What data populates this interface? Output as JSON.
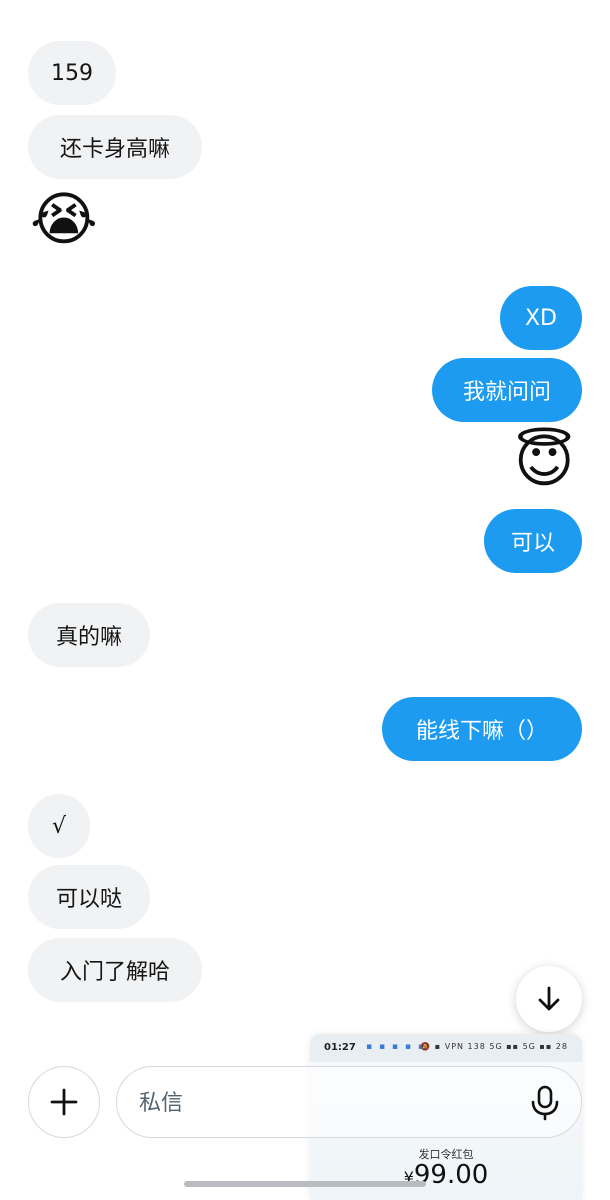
{
  "header": {
    "clipped_text": "· · · · · · · · · · ·"
  },
  "messages": [
    {
      "side": "in",
      "text": "159"
    },
    {
      "side": "in",
      "text": "还卡身高嘛"
    },
    {
      "side": "in",
      "emoji": "😭",
      "icon": "loudly-crying-face"
    },
    {
      "side": "out",
      "text": "XD"
    },
    {
      "side": "out",
      "text": "我就问问"
    },
    {
      "side": "out",
      "emoji": "😇",
      "icon": "smiling-face-with-halo"
    },
    {
      "side": "out",
      "text": "可以"
    },
    {
      "side": "in",
      "text": "真的嘛"
    },
    {
      "side": "out",
      "text": "能线下嘛（）"
    },
    {
      "side": "in",
      "text": "√"
    },
    {
      "side": "in",
      "text": "可以哒"
    },
    {
      "side": "in",
      "text": "入门了解哈"
    }
  ],
  "thumbnail": {
    "time": "01:27",
    "status_icons": "▪ ▪ ▪ ▪ ▪",
    "status_right": "🔕 ▪ VPN 138 5G ▪▪ 5G ▪▪ 28",
    "label": "发口令红包",
    "currency": "¥",
    "amount": "99.00"
  },
  "composer": {
    "placeholder": "私信"
  },
  "colors": {
    "outgoing_bubble": "#1c9bf0",
    "incoming_bubble": "#f1f2f4",
    "text_dark": "#151515",
    "placeholder": "#536471"
  }
}
